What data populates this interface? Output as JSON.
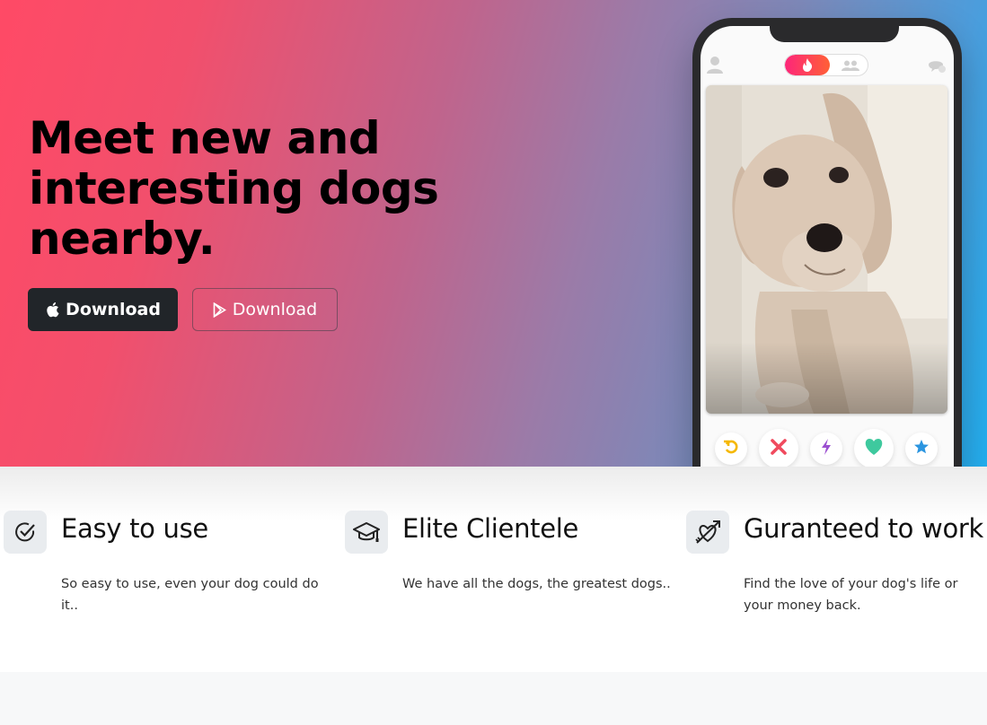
{
  "hero": {
    "title": "Meet new and interesting dogs nearby.",
    "buttons": {
      "apple_label": "Download",
      "play_label": "Download"
    },
    "apple_icon": "apple-icon",
    "play_icon": "google-play-icon"
  },
  "phone": {
    "top_icons": [
      "profile-icon",
      "flame-icon",
      "group-icon",
      "chat-icon"
    ],
    "actions": [
      {
        "icon": "rewind-icon",
        "color": "#f5b800"
      },
      {
        "icon": "nope-x-icon",
        "color": "#f04a5e"
      },
      {
        "icon": "boost-bolt-icon",
        "color": "#9b4fd0"
      },
      {
        "icon": "like-heart-icon",
        "color": "#3ec99e"
      },
      {
        "icon": "super-like-star-icon",
        "color": "#2b95e0"
      }
    ]
  },
  "features": [
    {
      "icon": "check-circle-icon",
      "title": "Easy to use",
      "desc": "So easy to use, even your dog could do it.."
    },
    {
      "icon": "graduation-cap-icon",
      "title": "Elite Clientele",
      "desc": "We have all the dogs, the greatest dogs.."
    },
    {
      "icon": "heart-arrow-icon",
      "title": "Guranteed to work",
      "desc": "Find the love of your dog's life or your money back."
    }
  ],
  "colors": {
    "gradient_start": "#ff4a66",
    "gradient_end": "#22aff0",
    "dark_button": "#212529"
  }
}
